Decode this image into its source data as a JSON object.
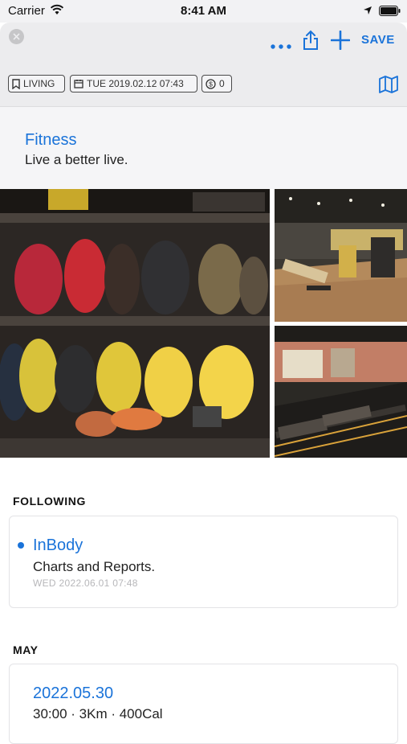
{
  "status_bar": {
    "carrier": "Carrier",
    "time": "8:41 AM"
  },
  "toolbar": {
    "save_label": "SAVE",
    "icons": [
      "close-icon",
      "more-icon",
      "share-icon",
      "add-icon",
      "map-icon"
    ],
    "accent_color": "#1a73d9"
  },
  "chips": {
    "category": "LIVING",
    "datetime": "TUE 2019.02.12 07:43",
    "count": "0"
  },
  "header": {
    "title": "Fitness",
    "subtitle": "Live a better live."
  },
  "photos": [
    "boxing gloves on shelves",
    "gym weight machines",
    "treadmills row"
  ],
  "following": {
    "label": "FOLLOWING",
    "item": {
      "title": "InBody",
      "subtitle": "Charts and Reports.",
      "time": "WED 2022.06.01 07:48"
    }
  },
  "may": {
    "label": "MAY",
    "item": {
      "title": "2022.05.30",
      "subtitle": "30:00 · 3Km · 400Cal"
    }
  }
}
